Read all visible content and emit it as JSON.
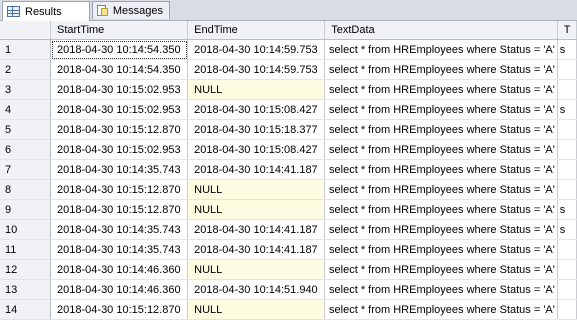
{
  "tabs": [
    {
      "label": "Results",
      "icon": "grid-icon",
      "active": true
    },
    {
      "label": "Messages",
      "icon": "messages-icon",
      "active": false
    }
  ],
  "columns": [
    "",
    "StartTime",
    "EndTime",
    "TextData",
    "T"
  ],
  "rows": [
    {
      "n": "1",
      "start": "2018-04-30 10:14:54.350",
      "end": "2018-04-30 10:14:59.753",
      "text": "select * from HREmployees where Status = 'A'",
      "extra": "s"
    },
    {
      "n": "2",
      "start": "2018-04-30 10:14:54.350",
      "end": "2018-04-30 10:14:59.753",
      "text": "select * from HREmployees where Status = 'A'",
      "extra": ""
    },
    {
      "n": "3",
      "start": "2018-04-30 10:15:02.953",
      "end": "NULL",
      "text": "select * from HREmployees where Status = 'A'",
      "extra": ""
    },
    {
      "n": "4",
      "start": "2018-04-30 10:15:02.953",
      "end": "2018-04-30 10:15:08.427",
      "text": "select * from HREmployees where Status = 'A'",
      "extra": "s"
    },
    {
      "n": "5",
      "start": "2018-04-30 10:15:12.870",
      "end": "2018-04-30 10:15:18.377",
      "text": "select * from HREmployees where Status = 'A'",
      "extra": ""
    },
    {
      "n": "6",
      "start": "2018-04-30 10:15:02.953",
      "end": "2018-04-30 10:15:08.427",
      "text": "select * from HREmployees where Status = 'A'",
      "extra": ""
    },
    {
      "n": "7",
      "start": "2018-04-30 10:14:35.743",
      "end": "2018-04-30 10:14:41.187",
      "text": "select * from HREmployees where Status = 'A'",
      "extra": ""
    },
    {
      "n": "8",
      "start": "2018-04-30 10:15:12.870",
      "end": "NULL",
      "text": "select * from HREmployees where Status = 'A'",
      "extra": ""
    },
    {
      "n": "9",
      "start": "2018-04-30 10:15:12.870",
      "end": "NULL",
      "text": "select * from HREmployees where Status = 'A'",
      "extra": "s"
    },
    {
      "n": "10",
      "start": "2018-04-30 10:14:35.743",
      "end": "2018-04-30 10:14:41.187",
      "text": "select * from HREmployees where Status = 'A'",
      "extra": "s"
    },
    {
      "n": "11",
      "start": "2018-04-30 10:14:35.743",
      "end": "2018-04-30 10:14:41.187",
      "text": "select * from HREmployees where Status = 'A'",
      "extra": ""
    },
    {
      "n": "12",
      "start": "2018-04-30 10:14:46.360",
      "end": "NULL",
      "text": "select * from HREmployees where Status = 'A'",
      "extra": ""
    },
    {
      "n": "13",
      "start": "2018-04-30 10:14:46.360",
      "end": "2018-04-30 10:14:51.940",
      "text": "select * from HREmployees where Status = 'A'",
      "extra": ""
    },
    {
      "n": "14",
      "start": "2018-04-30 10:15:12.870",
      "end": "NULL",
      "text": "select * from HREmployees where Status = 'A'",
      "extra": ""
    }
  ]
}
